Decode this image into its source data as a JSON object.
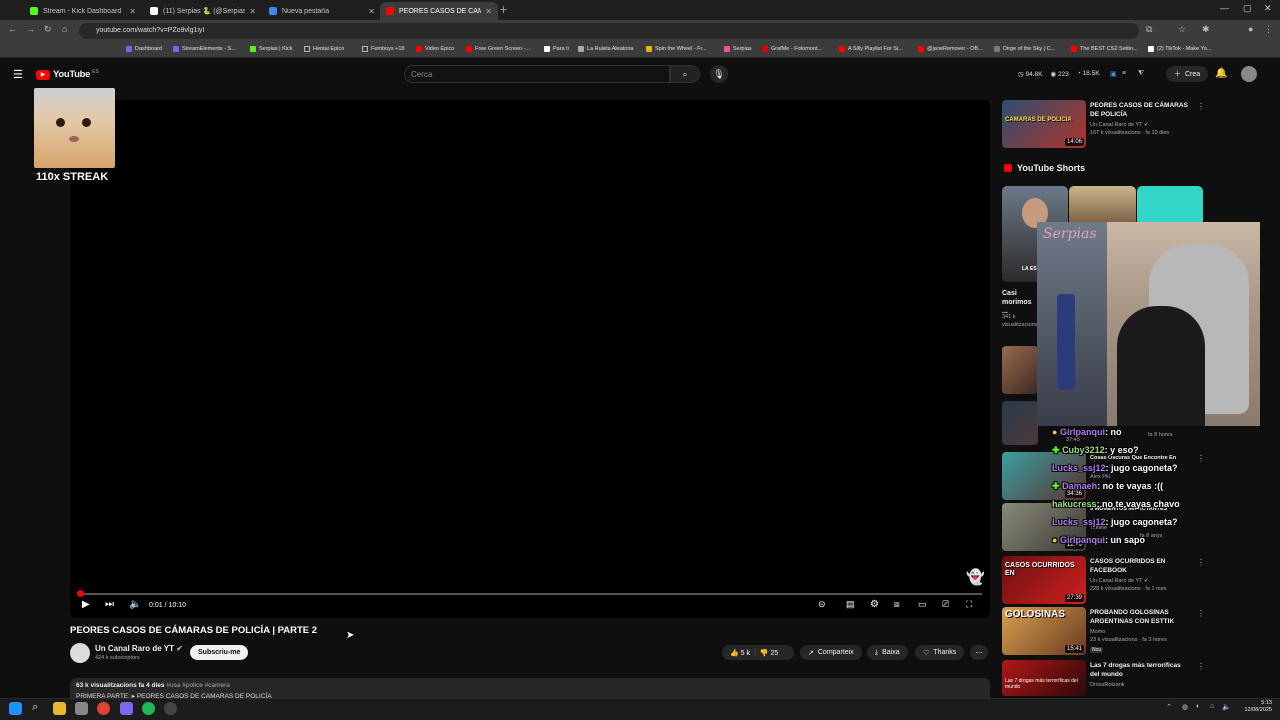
{
  "browser": {
    "tabs": [
      {
        "title": "Stream - Kick Dashboard",
        "color": "#53fc18"
      },
      {
        "title": "(11) Serpias 🐍 (@Serpias) / X",
        "color": "#ffffff"
      },
      {
        "title": "Nueva pestaña",
        "color": "#4285f4"
      },
      {
        "title": "PEORES CASOS DE CÁMARAS",
        "color": "#ff0000"
      }
    ],
    "url": "youtube.com/watch?v=PZo9vlg1iyI",
    "bookmarks": [
      "Dashboard",
      "StreamElements - S...",
      "Serpias | Kick",
      "Hentai Epico",
      "Femboys +18",
      "Video Epico",
      "Free Green Screen -...",
      "Para ti",
      "La Ruleta Aleatoria",
      "Spin the Wheel - Fr...",
      "Serpias",
      "GrafMe - Fotomont...",
      "A Silly Playlist For Si...",
      "@janeRemover - OB...",
      "Dirge of the Sky | C...",
      "The BEST CS2 Settin...",
      "(2) TikTok - Make Yo..."
    ]
  },
  "youtube": {
    "logo": "YouTube",
    "region": "ES",
    "search_placeholder": "Cerca",
    "stats": {
      "views": "94.8K",
      "likes": "223",
      "subs": "18.5K"
    },
    "create_label": "Crea"
  },
  "overlay": {
    "streak_label": "110x STREAK"
  },
  "player": {
    "time": "0:01 / 10:10",
    "progress": 0.002
  },
  "video": {
    "title": "PEORES CASOS DE CÁMARAS DE POLICÍA | PARTE 2",
    "channel": "Un Canal Raro de YT",
    "subscribers": "424 k subscriptors",
    "subscribe_label": "Subscriu-me",
    "likes": "5 k",
    "dislikes": "25",
    "share_label": "Comparteix",
    "download_label": "Baixa",
    "thanks_label": "Thanks",
    "views_line": "63 k visualitzacions  fa 4 dies",
    "hashtags": "#usa #police #camera",
    "desc_line": "PRIMERA PARTE: ▸ PEORES CASOS DE CAMARAS DE POLICÍA"
  },
  "sidebar": {
    "top_video": {
      "title": "PEORES CASOS DE CÁMARAS DE POLICÍA",
      "channel": "Un Canal Raro de YT",
      "meta": "167 k visualitzacions · fa 10 dies",
      "duration": "14:06",
      "thumb_text": "CAMARAS DE POLICIA"
    },
    "shorts_heading": "YouTube Shorts",
    "short": {
      "title": "Casi morimos ...",
      "meta": "341 k visualitzacions",
      "thumb_text": "LA ES"
    },
    "rec": [
      {
        "title": "Cosas Oscuras Que Encontre En",
        "channel": "Alex Pki",
        "meta": "",
        "duration": "34:36"
      },
      {
        "title": "5 MOMENTOS IMPACTANTES",
        "channel": "Tiiffiine",
        "meta": "fa 8 anys",
        "duration": "12:49"
      },
      {
        "title": "CASOS OCURRIDOS EN FACEBOOK",
        "channel": "Un Canal Raro de YT",
        "meta": "228 k visualitzacions · fa 1 mes",
        "duration": "27:39",
        "thumb_text": "CASOS OCURRIDOS EN"
      },
      {
        "title": "PROBANDO GOLOSINAS ARGENTINAS CON ESTTIK",
        "channel": "Momo",
        "meta": "23 k visualitzacions · fa 3 hores",
        "duration": "15:41",
        "thumb_text": "GOLOSINAS",
        "badge": "Nou"
      },
      {
        "title": "Las 7 drogas más terroríficas del mundo",
        "channel": "DrossRotzank",
        "meta": "",
        "duration": "",
        "thumb_text": "Las 7 drogas más terroríficas del mundo"
      }
    ],
    "hidden_meta_1": "37:45",
    "hidden_meta_2": "fa 8 hores"
  },
  "webcam": {
    "name_tag": "Serpias"
  },
  "chat": [
    {
      "user": "Girlpanqui",
      "msg": ": no",
      "green": false
    },
    {
      "user": "Cuby3212",
      "msg": ": y eso?",
      "green": true
    },
    {
      "user": "Lucks_ssj12",
      "msg": ": jugo cagoneta?",
      "green": false
    },
    {
      "user": "Damaeh",
      "msg": ": no te vayas :((",
      "green": false
    },
    {
      "user": "hakucress",
      "msg": ": no te vayas chavo",
      "green": true
    },
    {
      "user": "Lucks_ssj12",
      "msg": ": jugo cagoneta?",
      "green": false
    },
    {
      "user": "Girlpanqui",
      "msg": ": un sapo",
      "green": false
    }
  ],
  "taskbar": {
    "time": "5:13",
    "date": "12/08/2025"
  }
}
